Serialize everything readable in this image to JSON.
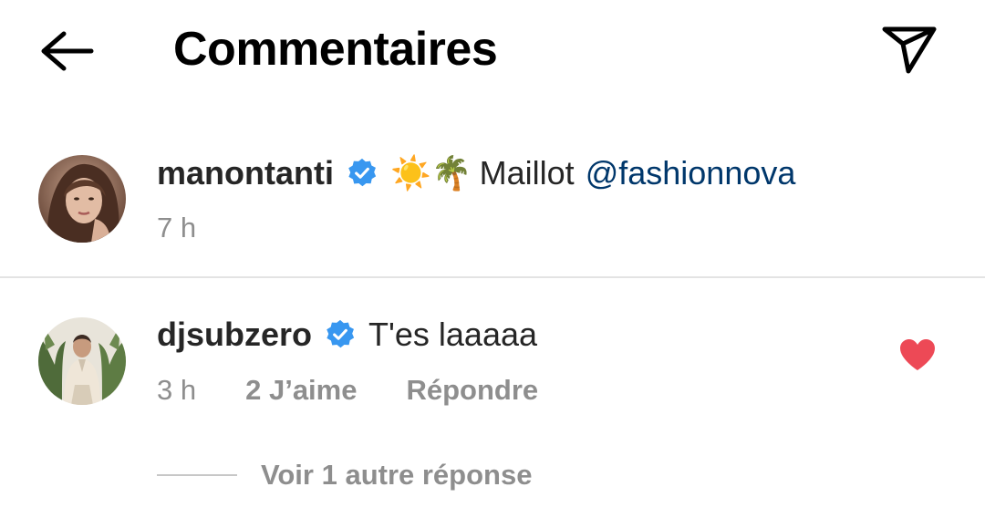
{
  "header": {
    "title": "Commentaires",
    "back_icon": "arrow-left-icon",
    "share_icon": "paper-plane-icon"
  },
  "caption": {
    "username": "manontanti",
    "verified": true,
    "emoji": "☀️🌴",
    "text": "Maillot",
    "mention": "@fashionnova",
    "time": "7 h"
  },
  "comments": [
    {
      "username": "djsubzero",
      "verified": true,
      "text": "T'es laaaaa",
      "time": "3 h",
      "likes": "2 J’aime",
      "reply_label": "Répondre",
      "liked": true,
      "view_replies_label": "Voir 1 autre réponse"
    }
  ],
  "colors": {
    "verified": "#3897f0",
    "heart": "#ed4956",
    "mention": "#00376b",
    "secondary_text": "#8e8e8e"
  }
}
